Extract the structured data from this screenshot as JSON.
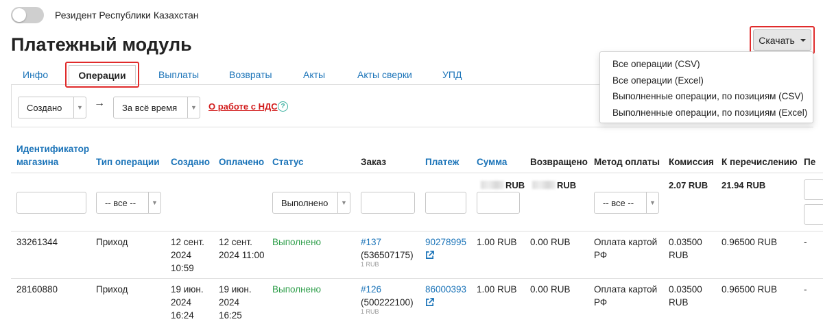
{
  "resident": {
    "label": "Резидент Республики Казахстан",
    "on": false
  },
  "page_title": "Платежный модуль",
  "download": {
    "label": "Скачать",
    "menu": [
      "Все операции (CSV)",
      "Все операции (Excel)",
      "Выполненные операции, по позициям (CSV)",
      "Выполненные операции, по позициям (Excel)"
    ]
  },
  "tabs": [
    "Инфо",
    "Операции",
    "Выплаты",
    "Возвраты",
    "Акты",
    "Акты сверки",
    "УПД"
  ],
  "active_tab": "Операции",
  "filters": {
    "date_field": "Создано",
    "arrow": "→",
    "period": "За всё время",
    "nds_link": "О работе с НДС",
    "help": "?"
  },
  "table": {
    "headers": {
      "shop_id": [
        "Идентификатор",
        "магазина"
      ],
      "op_type": "Тип операции",
      "created": "Создано",
      "paid": "Оплачено",
      "status": "Статус",
      "order": "Заказ",
      "payment": "Платеж",
      "sum": "Сумма",
      "refunded": "Возвращено",
      "method": "Метод оплаты",
      "commission": "Комиссия",
      "transfer": "К перечислению",
      "next": "Пе"
    },
    "filter_row": {
      "op_type": "-- все --",
      "status": "Выполнено",
      "method": "-- все --",
      "sum_currency": "RUB",
      "refunded_currency": "RUB",
      "commission_total": "2.07 RUB",
      "transfer_total": "21.94 RUB"
    },
    "rows": [
      {
        "shop_id": "33261344",
        "op_type": "Приход",
        "created": [
          "12 сент.",
          "2024",
          "10:59"
        ],
        "paid": [
          "12 сент.",
          "2024 11:00"
        ],
        "status": "Выполнено",
        "order_link": "#137",
        "order_num": "(536507175)",
        "order_sub": "1 RUB",
        "payment": "90278995",
        "sum": "1.00 RUB",
        "refunded": "0.00 RUB",
        "method": [
          "Оплата картой",
          "РФ"
        ],
        "commission": [
          "0.03500",
          "RUB"
        ],
        "transfer": "0.96500 RUB",
        "next": "-"
      },
      {
        "shop_id": "28160880",
        "op_type": "Приход",
        "created": [
          "19 июн.",
          "2024",
          "16:24"
        ],
        "paid": [
          "19 июн.",
          "2024",
          "16:25"
        ],
        "status": "Выполнено",
        "order_link": "#126",
        "order_num": "(500222100)",
        "order_sub": "1 RUB",
        "payment": "86000393",
        "sum": "1.00 RUB",
        "refunded": "0.00 RUB",
        "method": [
          "Оплата картой",
          "РФ"
        ],
        "commission": [
          "0.03500",
          "RUB"
        ],
        "transfer": "0.96500 RUB",
        "next": "-"
      }
    ]
  }
}
